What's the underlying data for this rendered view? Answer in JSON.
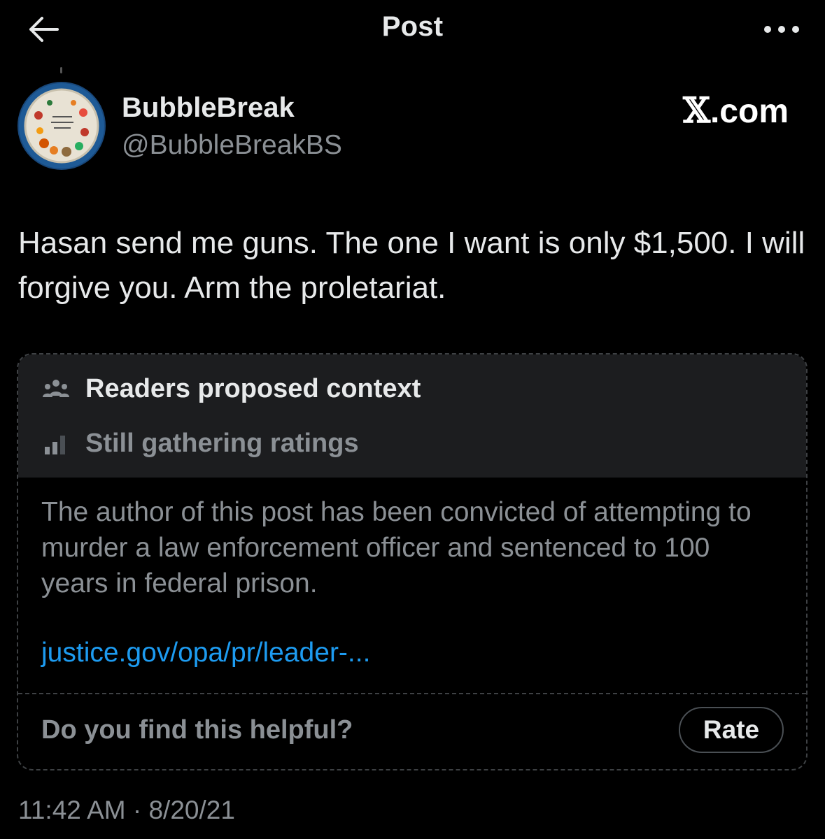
{
  "header": {
    "title": "Post",
    "back_icon": "arrow-left-icon",
    "more_icon": "more-horizontal-icon"
  },
  "author": {
    "name": "BubbleBreak",
    "handle": "@BubbleBreakBS"
  },
  "branding": {
    "x_mark": "𝕏",
    "com": ".com"
  },
  "post": {
    "text": "Hasan send me guns. The one I want is only $1,500. I will forgive you. Arm the proletariat.",
    "timestamp": "11:42 AM · 8/20/21"
  },
  "community_note": {
    "title": "Readers proposed context",
    "title_icon": "people-icon",
    "status": "Still gathering ratings",
    "status_icon": "bar-chart-icon",
    "body": "The author of this post has been convicted of attempting to murder a law enforcement officer and sentenced to 100 years in federal prison.",
    "link": "justice.gov/opa/pr/leader-...",
    "helpful_prompt": "Do you find this helpful?",
    "rate_label": "Rate"
  },
  "colors": {
    "background": "#000000",
    "text_primary": "#e7e9ea",
    "text_secondary": "#8b9095",
    "link": "#1d9bf0",
    "note_header_bg": "#1c1d1f"
  }
}
